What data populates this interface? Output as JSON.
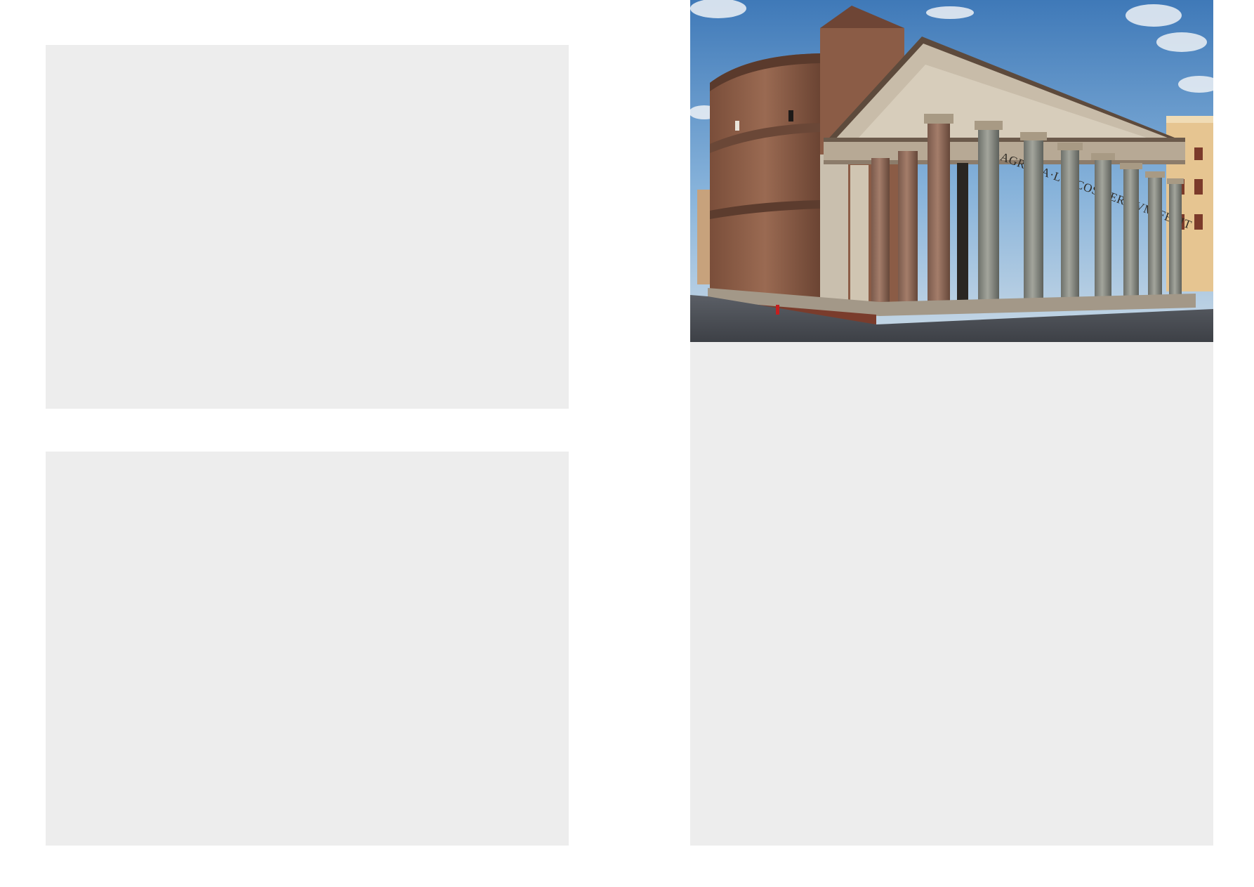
{
  "photo": {
    "subject_icon": "pantheon-photo",
    "inscription": "M·AGRIPPA·L·F·COS·TERTIVM·FECIT"
  },
  "colors": {
    "page_background": "#ffffff",
    "placeholder_panel": "#ededed"
  }
}
